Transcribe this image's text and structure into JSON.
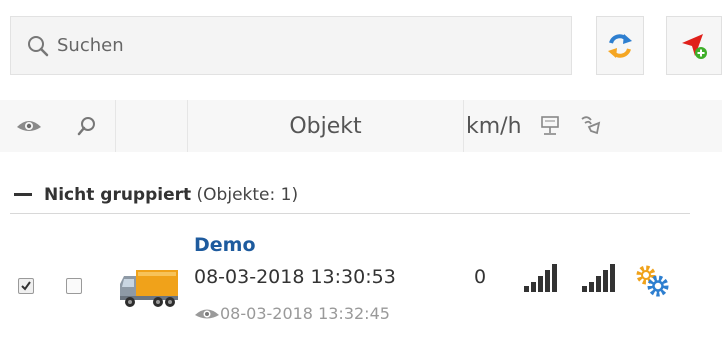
{
  "search": {
    "placeholder": "Suchen"
  },
  "toolbar": {
    "refresh_icon": "refresh-arrows-icon",
    "locate_icon": "navigate-add-icon"
  },
  "table_header": {
    "visibility_icon": "eye-icon",
    "find_icon": "search-icon",
    "object_label": "Objekt",
    "speed_label": "km/h",
    "gps_icon": "gps-signal-icon",
    "gsm_icon": "gsm-signal-icon"
  },
  "group": {
    "name": "Nicht gruppiert",
    "count_label": "(Objekte: 1)"
  },
  "objects": [
    {
      "name": "Demo",
      "last_message": "08-03-2018 13:30:53",
      "last_seen": "08-03-2018 13:32:45",
      "speed": "0",
      "visible_checked": true,
      "selected": false,
      "icon": "truck-icon",
      "gps_signal_bars": 4,
      "gsm_signal_bars": 4,
      "settings_icon": "gears-icon"
    }
  ],
  "colors": {
    "link": "#1e5b9e",
    "refresh_blue": "#2e7fd0",
    "refresh_orange": "#f5a623",
    "locate_red": "#e0201b",
    "add_green": "#3fae2a"
  }
}
